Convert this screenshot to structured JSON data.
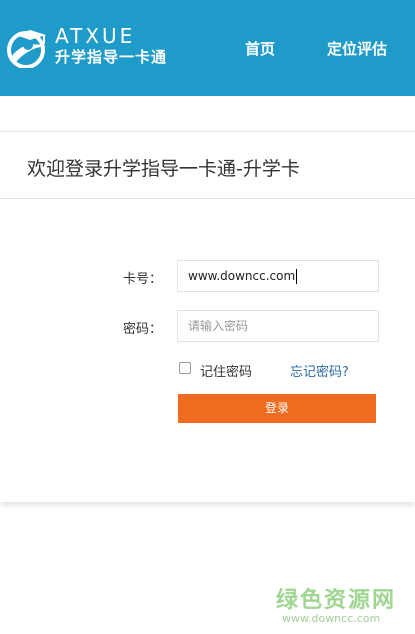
{
  "header": {
    "logo_en": "ATXUE",
    "logo_cn": "升学指导一卡通",
    "nav": [
      {
        "label": "首页"
      },
      {
        "label": "定位评估"
      }
    ]
  },
  "login": {
    "title": "欢迎登录升学指导一卡通-升学卡",
    "card_label": "卡号：",
    "card_value": "www.downcc.com",
    "password_label": "密码：",
    "password_placeholder": "请输入密码",
    "remember_label": "记住密码",
    "remember_checked": false,
    "forgot_label": "忘记密码?",
    "submit_label": "登录"
  },
  "watermark": {
    "cn": "绿色资源网",
    "en": "www.downcc.com"
  },
  "colors": {
    "header_bg": "#1f9bc9",
    "button_bg": "#ee6b1f",
    "link": "#2c6aa8"
  }
}
